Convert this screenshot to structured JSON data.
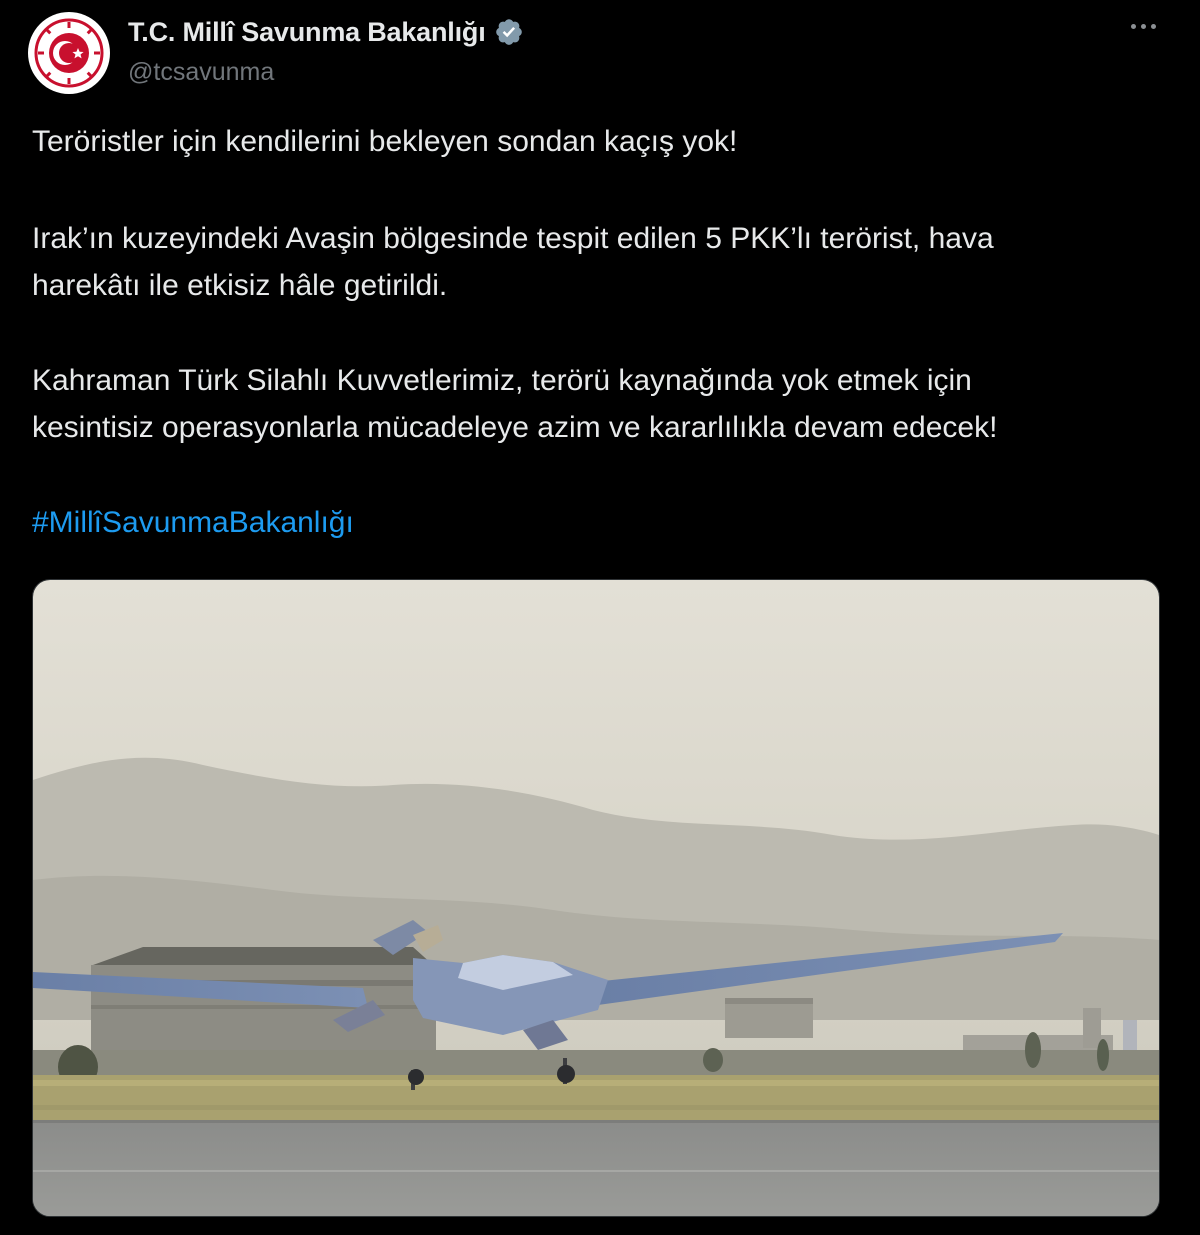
{
  "author": {
    "display_name": "T.C. Millî Savunma Bakanlığı",
    "handle": "@tcsavunma",
    "verified": true,
    "verified_color": "#829aab",
    "avatar_icon": "ministry-emblem-icon",
    "avatar_color": "#c8102e"
  },
  "tweet": {
    "paragraphs": [
      "Teröristler için kendilerini bekleyen sondan kaçış yok!",
      "Irak’ın kuzeyindeki Avaşin bölgesinde tespit edilen 5 PKK’lı terörist, hava",
      "harekâtı ile etkisiz hâle getirildi.",
      "Kahraman Türk Silahlı Kuvvetlerimiz, terörü kaynağında yok etmek için",
      "kesintisiz operasyonlarla mücadeleye azim ve kararlılıkla devam edecek!"
    ],
    "hashtag": "#MillîSavunmaBakanlığı",
    "hashtag_color": "#1d9bf0"
  },
  "media": {
    "type": "video-frame",
    "subject": "drone-taking-off-photo"
  },
  "menu_icon": "more-options-icon"
}
